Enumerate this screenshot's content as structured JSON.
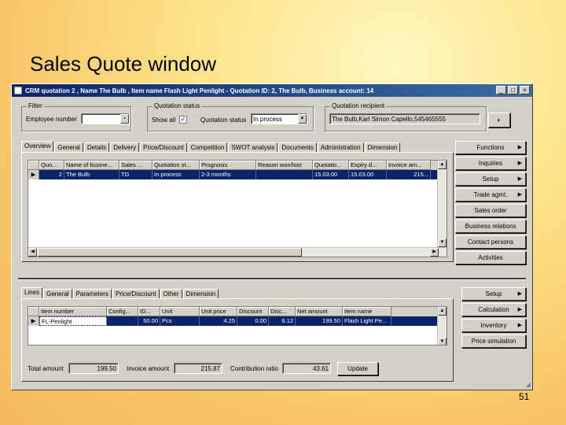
{
  "slide": {
    "title": "Sales Quote window",
    "page_number": "51"
  },
  "window": {
    "title": "CRM quotation 2 , Name The Bulb , Item name Flash Light Penlight - Quotation ID: 2, The Bulb, Business account: 14"
  },
  "filter": {
    "caption": "Filter",
    "employee_label": "Employee number",
    "employee_value": ""
  },
  "status": {
    "caption": "Quotation status",
    "show_all_label": "Show all",
    "show_all_checked": "✓",
    "status_label": "Quotation status",
    "status_value": "In process"
  },
  "recipient": {
    "caption": "Quotation recipient",
    "value": "The Bulb,Karl Simon Capello,545465555"
  },
  "top_tabs": [
    "Overview",
    "General",
    "Details",
    "Delivery",
    "Price/Discount",
    "Competition",
    "SWOT analysis",
    "Documents",
    "Administration",
    "Dimension"
  ],
  "top_grid": {
    "headers": [
      "Quo...",
      "Name of busine...",
      "Sales ...",
      "Quotation st...",
      "Prognosis",
      "Reason won/lost",
      "Quotatio...",
      "Expiry d...",
      "Invoice am..."
    ],
    "row": [
      "2",
      "The Bulb",
      "TG",
      "In process",
      "2-3 months",
      "",
      "15.03.00",
      "15.03.00",
      "215..."
    ]
  },
  "right_buttons": [
    "Functions",
    "Inquiries",
    "Setup",
    "Trade agmt.",
    "Sales order",
    "Business relations",
    "Contact persons",
    "Activities"
  ],
  "bottom_tabs": [
    "Lines",
    "General",
    "Parameters",
    "Price/Discount",
    "Other",
    "Dimension"
  ],
  "bottom_grid": {
    "headers": [
      "Item number",
      "Config...",
      "ID...",
      "Unit",
      "Unit price",
      "Discount",
      "Disc...",
      "Net amount",
      "Item name"
    ],
    "row": [
      "FL-Penlight",
      "",
      "50.00",
      "Pcs",
      "4.25",
      "0.00",
      "6.12",
      "199.50",
      "Flash Light Pe..."
    ]
  },
  "lower_buttons": [
    "Setup",
    "Calculation",
    "Inventory",
    "Price simulation"
  ],
  "totals": {
    "total_label": "Total amount",
    "total_value": "199.50",
    "invoice_label": "Invoice amount",
    "invoice_value": "215.87",
    "contrib_label": "Contribution ratio",
    "contrib_value": "43.61",
    "update_label": "Update"
  }
}
